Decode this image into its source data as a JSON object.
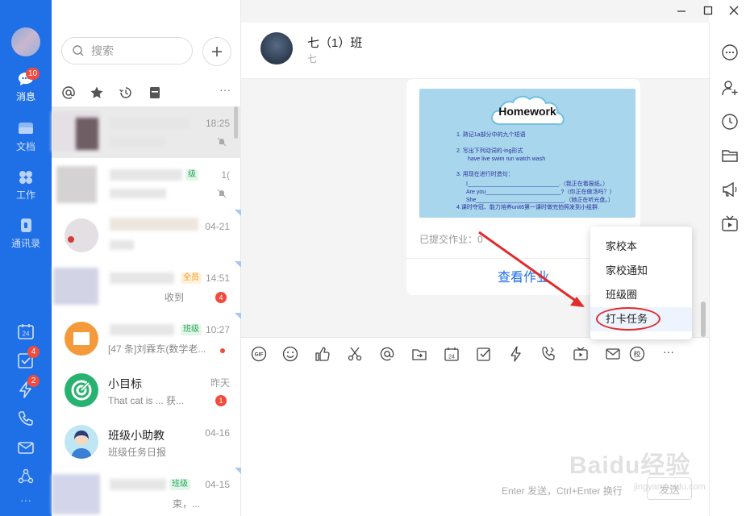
{
  "nav": {
    "items": [
      {
        "label": "消息",
        "icon": "message-icon",
        "badge": "10"
      },
      {
        "label": "文档",
        "icon": "document-icon"
      },
      {
        "label": "工作",
        "icon": "work-grid-icon"
      },
      {
        "label": "通讯录",
        "icon": "contacts-icon"
      }
    ],
    "bottom": [
      {
        "icon": "calendar-icon",
        "text": "24"
      },
      {
        "icon": "task-check-icon",
        "badge": "4"
      },
      {
        "icon": "lightning-icon",
        "badge": "2"
      },
      {
        "icon": "phone-icon"
      },
      {
        "icon": "mail-icon"
      },
      {
        "icon": "org-icon"
      },
      {
        "icon": "more-dots-icon",
        "text": "···"
      }
    ]
  },
  "search": {
    "placeholder": "搜索"
  },
  "filters": [
    "at-icon",
    "star-icon",
    "history-icon",
    "archive-icon",
    "more-dots-icon"
  ],
  "filters_more": "···",
  "conversations": [
    {
      "time": "18:25"
    },
    {
      "time": "1("
    },
    {
      "time": "04-21"
    },
    {
      "time": "14:51",
      "tag": "全员",
      "preview": "收到",
      "badge": "4"
    },
    {
      "time": "10:27",
      "tag": "班级",
      "preview": "[47 条]刘霖东(数学老..."
    },
    {
      "name": "小目标",
      "time": "昨天",
      "preview": "That  cat  is  ... 获...",
      "badge": "1"
    },
    {
      "name": "班级小助教",
      "time": "04-16",
      "preview": "班级任务日报"
    },
    {
      "time": "04-15",
      "tag": "班级",
      "preview": "束，..."
    }
  ],
  "chat": {
    "group_name": "七（1）班",
    "group_sub": "七",
    "card": {
      "image_title": "Homework",
      "lines": [
        "1. 熟记1a部分中的九个短语",
        "2. 写出下列动词的-ing形式",
        "have     live     swim     run     watch     wash",
        "3. 用现在进行时造句：",
        "I_____________________________.（我正在看报纸。）",
        "Are you________________________?（你正在做汤吗？）",
        "She____________________________.（她正在听光盘。）",
        "4.课时夺冠、能力培养unit6第一课时做完拍照发到小组群."
      ],
      "submitted": "已提交作业：0",
      "view_button": "查看作业"
    },
    "toolbar_gif": "GIF",
    "toolbar_calendar": "24",
    "toolbar_school": "校",
    "toolbar_more": "···",
    "toolbar": [
      "gif-icon",
      "emoji-icon",
      "thumbs-up-icon",
      "scissors-icon",
      "at-icon",
      "folder-send-icon",
      "calendar-icon",
      "checkbox-icon",
      "lightning-icon",
      "call-icon",
      "video-icon",
      "mail-icon",
      "school-icon",
      "more-dots-icon"
    ],
    "input_hint": "Enter 发送，Ctrl+Enter 换行",
    "send_label": "发送"
  },
  "popup_menu": {
    "items": [
      "家校本",
      "家校通知",
      "班级圈",
      "打卡任务"
    ],
    "highlighted": "打卡任务"
  },
  "right_panel": [
    "more-circle-icon",
    "add-member-icon",
    "history-clock-icon",
    "folder-icon",
    "announcement-icon",
    "live-tv-icon"
  ],
  "watermark": {
    "main": "Baidu经验",
    "sub": "jingyan.baidu.com"
  },
  "colors": {
    "brand": "#1f6fe6",
    "badge": "#f24a3d",
    "highlight_ring": "#e02b2b"
  }
}
